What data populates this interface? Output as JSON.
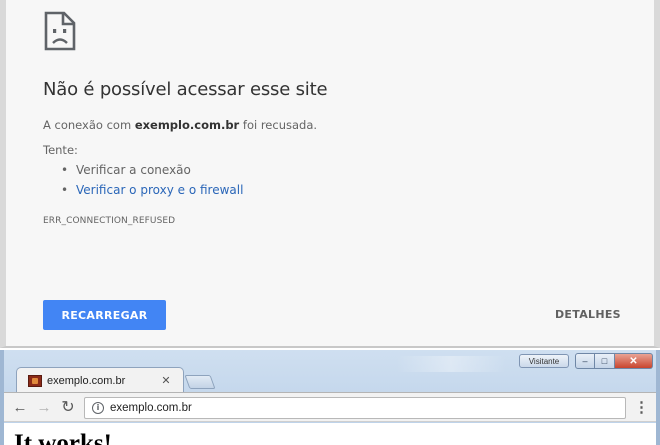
{
  "error_page": {
    "icon": "sad-document-icon",
    "title": "Não é possível acessar esse site",
    "message_prefix": "A conexão com ",
    "host": "exemplo.com.br",
    "message_suffix": " foi recusada.",
    "try_label": "Tente:",
    "suggestions": [
      {
        "label": "Verificar a conexão",
        "is_link": false
      },
      {
        "label": "Verificar o proxy e o firewall",
        "is_link": true
      }
    ],
    "error_code": "ERR_CONNECTION_REFUSED",
    "reload_label": "RECARREGAR",
    "details_label": "DETALHES",
    "accent_color": "#4285f4",
    "link_color": "#2a66b8"
  },
  "browser": {
    "profile_label": "Visitante",
    "window_controls": {
      "minimize": "–",
      "maximize": "□",
      "close": "✕"
    },
    "tab": {
      "title": "exemplo.com.br",
      "close": "✕",
      "favicon": "site-favicon-icon"
    },
    "toolbar": {
      "back": "←",
      "forward": "→",
      "reload": "↻",
      "url": "exemplo.com.br",
      "info": "i",
      "menu": "⋮"
    },
    "page_heading": "It works!"
  }
}
